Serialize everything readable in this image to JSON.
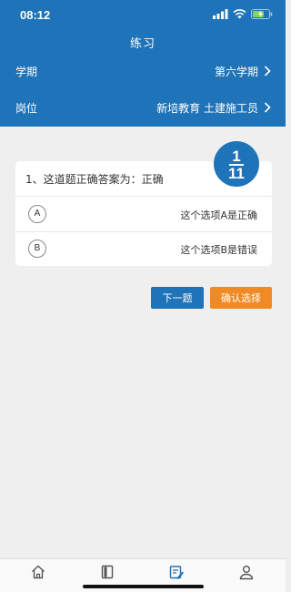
{
  "status_bar": {
    "time": "08:12"
  },
  "header": {
    "title": "练习",
    "term": {
      "label": "学期",
      "value": "第六学期"
    },
    "post": {
      "label": "岗位",
      "value": "新培教育 土建施工员"
    }
  },
  "question": {
    "text": "1、这道题正确答案为：正确",
    "current": "1",
    "total": "11",
    "options": [
      {
        "letter": "A",
        "text": "这个选项A是正确"
      },
      {
        "letter": "B",
        "text": "这个选项B是错误"
      }
    ]
  },
  "actions": {
    "next_label": "下一题",
    "confirm_label": "确认选择"
  },
  "colors": {
    "primary": "#1f73b8",
    "accent": "#f08a24",
    "background": "#efefef"
  },
  "tabbar": {
    "icons": [
      "home-icon",
      "book-icon",
      "practice-icon",
      "profile-icon"
    ],
    "active": "practice-icon"
  }
}
